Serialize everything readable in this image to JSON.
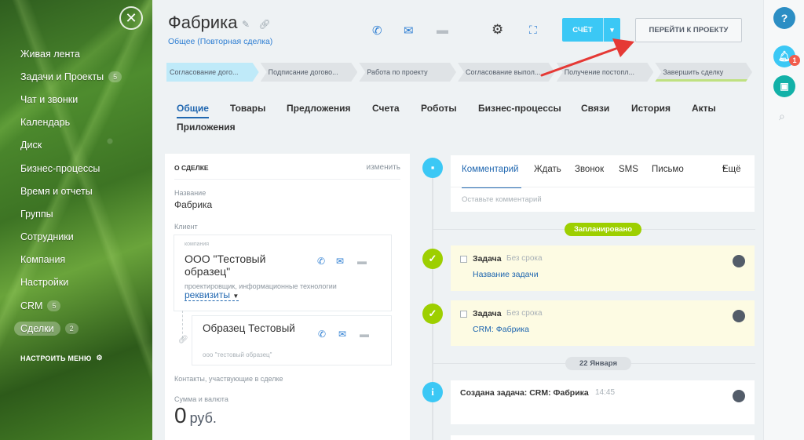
{
  "sidebar": {
    "close_glyph": "✕",
    "items": [
      {
        "label": "Живая лента",
        "count": ""
      },
      {
        "label": "Задачи и Проекты",
        "count": "5"
      },
      {
        "label": "Чат и звонки",
        "count": ""
      },
      {
        "label": "Календарь",
        "count": ""
      },
      {
        "label": "Диск",
        "count": ""
      },
      {
        "label": "Бизнес-процессы",
        "count": ""
      },
      {
        "label": "Время и отчеты",
        "count": ""
      },
      {
        "label": "Группы",
        "count": ""
      },
      {
        "label": "Сотрудники",
        "count": ""
      },
      {
        "label": "Компания",
        "count": ""
      },
      {
        "label": "Настройки",
        "count": ""
      },
      {
        "label": "CRM",
        "count": "5"
      },
      {
        "label": "Сделки",
        "count": "2"
      }
    ],
    "settings_label": "НАСТРОИТЬ МЕНЮ"
  },
  "header": {
    "title": "Фабрика",
    "subtitle": "Общее (Повторная сделка)",
    "invoice_button": "СЧЁТ",
    "project_button": "ПЕРЕЙТИ К ПРОЕКТУ",
    "icons": [
      "phone-icon",
      "mail-icon",
      "chat-icon",
      "gear-icon",
      "expand-icon"
    ]
  },
  "stages": [
    "Согласование дого...",
    "Подписание догово...",
    "Работа по проекту",
    "Согласование выпол...",
    "Получение постопл...",
    "Завершить сделку"
  ],
  "tabs": [
    "Общие",
    "Товары",
    "Предложения",
    "Счета",
    "Роботы",
    "Бизнес-процессы",
    "Связи",
    "История",
    "Акты",
    "Приложения"
  ],
  "deal": {
    "section_title": "О СДЕЛКЕ",
    "edit_label": "изменить",
    "name_label": "Название",
    "name_value": "Фабрика",
    "client_label": "Клиент",
    "company_small": "компания",
    "company_name": "ООО \"Тестовый образец\"",
    "company_desc": "проектировщик, информационные технологии",
    "requisites": "реквизиты",
    "contact_name": "Образец Тестовый",
    "contact_company": "ооо \"тестовый образец\"",
    "contacts_label": "Контакты, участвующие в сделке",
    "amount_label": "Сумма и валюта",
    "amount_value": "0",
    "currency": "руб."
  },
  "timeline": {
    "comment_tabs": [
      "Комментарий",
      "Ждать",
      "Звонок",
      "SMS",
      "Письмо",
      "Ещё"
    ],
    "comment_placeholder": "Оставьте комментарий",
    "planned_badge": "Запланировано",
    "tasks": [
      {
        "title": "Задача",
        "meta": "Без срока",
        "link": "Название задачи"
      },
      {
        "title": "Задача",
        "meta": "Без срока",
        "link": "CRM: Фабрика"
      }
    ],
    "date_badge": "22 Января",
    "event_title": "Создана задача: CRM: Фабрика",
    "event_time": "14:45"
  },
  "rail": {
    "help": "?",
    "notifications_count": "1"
  },
  "colors": {
    "accent_blue": "#3bc8f5",
    "link_blue": "#2067b0",
    "green": "#9dcf00",
    "annotation_red": "#e53935"
  }
}
